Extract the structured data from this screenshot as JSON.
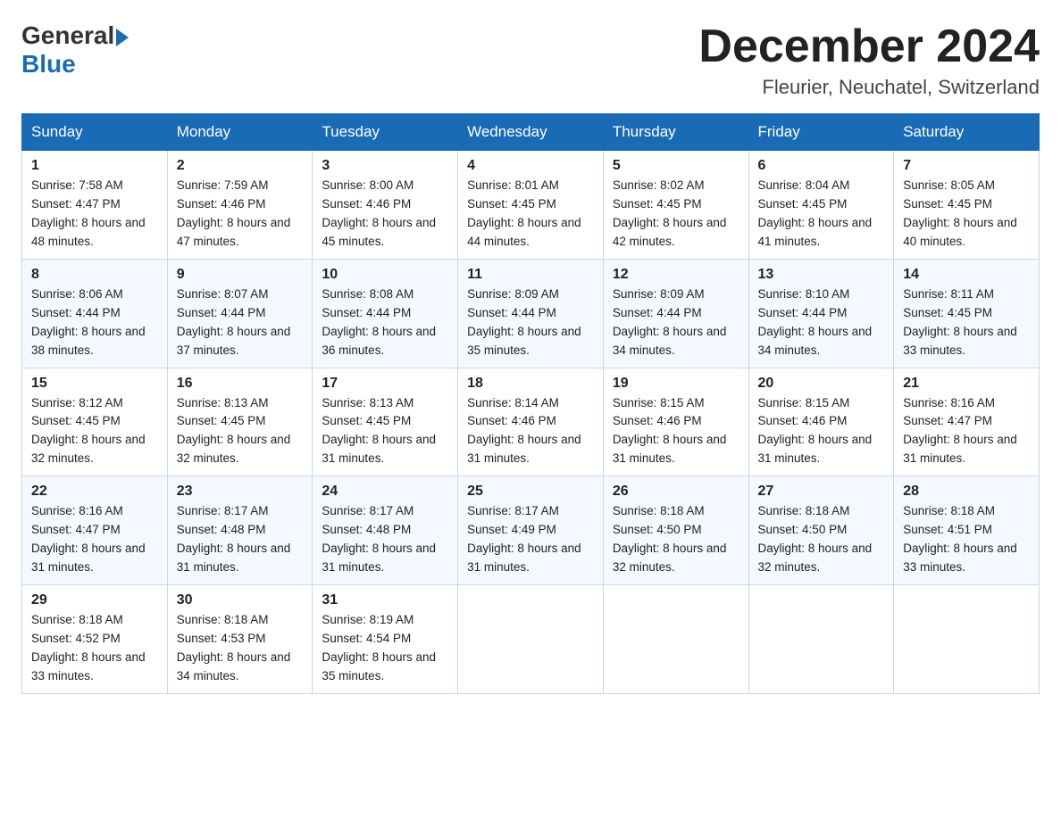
{
  "header": {
    "month_title": "December 2024",
    "location": "Fleurier, Neuchatel, Switzerland"
  },
  "columns": [
    "Sunday",
    "Monday",
    "Tuesday",
    "Wednesday",
    "Thursday",
    "Friday",
    "Saturday"
  ],
  "weeks": [
    [
      {
        "day": "1",
        "sunrise": "7:58 AM",
        "sunset": "4:47 PM",
        "daylight": "8 hours and 48 minutes."
      },
      {
        "day": "2",
        "sunrise": "7:59 AM",
        "sunset": "4:46 PM",
        "daylight": "8 hours and 47 minutes."
      },
      {
        "day": "3",
        "sunrise": "8:00 AM",
        "sunset": "4:46 PM",
        "daylight": "8 hours and 45 minutes."
      },
      {
        "day": "4",
        "sunrise": "8:01 AM",
        "sunset": "4:45 PM",
        "daylight": "8 hours and 44 minutes."
      },
      {
        "day": "5",
        "sunrise": "8:02 AM",
        "sunset": "4:45 PM",
        "daylight": "8 hours and 42 minutes."
      },
      {
        "day": "6",
        "sunrise": "8:04 AM",
        "sunset": "4:45 PM",
        "daylight": "8 hours and 41 minutes."
      },
      {
        "day": "7",
        "sunrise": "8:05 AM",
        "sunset": "4:45 PM",
        "daylight": "8 hours and 40 minutes."
      }
    ],
    [
      {
        "day": "8",
        "sunrise": "8:06 AM",
        "sunset": "4:44 PM",
        "daylight": "8 hours and 38 minutes."
      },
      {
        "day": "9",
        "sunrise": "8:07 AM",
        "sunset": "4:44 PM",
        "daylight": "8 hours and 37 minutes."
      },
      {
        "day": "10",
        "sunrise": "8:08 AM",
        "sunset": "4:44 PM",
        "daylight": "8 hours and 36 minutes."
      },
      {
        "day": "11",
        "sunrise": "8:09 AM",
        "sunset": "4:44 PM",
        "daylight": "8 hours and 35 minutes."
      },
      {
        "day": "12",
        "sunrise": "8:09 AM",
        "sunset": "4:44 PM",
        "daylight": "8 hours and 34 minutes."
      },
      {
        "day": "13",
        "sunrise": "8:10 AM",
        "sunset": "4:44 PM",
        "daylight": "8 hours and 34 minutes."
      },
      {
        "day": "14",
        "sunrise": "8:11 AM",
        "sunset": "4:45 PM",
        "daylight": "8 hours and 33 minutes."
      }
    ],
    [
      {
        "day": "15",
        "sunrise": "8:12 AM",
        "sunset": "4:45 PM",
        "daylight": "8 hours and 32 minutes."
      },
      {
        "day": "16",
        "sunrise": "8:13 AM",
        "sunset": "4:45 PM",
        "daylight": "8 hours and 32 minutes."
      },
      {
        "day": "17",
        "sunrise": "8:13 AM",
        "sunset": "4:45 PM",
        "daylight": "8 hours and 31 minutes."
      },
      {
        "day": "18",
        "sunrise": "8:14 AM",
        "sunset": "4:46 PM",
        "daylight": "8 hours and 31 minutes."
      },
      {
        "day": "19",
        "sunrise": "8:15 AM",
        "sunset": "4:46 PM",
        "daylight": "8 hours and 31 minutes."
      },
      {
        "day": "20",
        "sunrise": "8:15 AM",
        "sunset": "4:46 PM",
        "daylight": "8 hours and 31 minutes."
      },
      {
        "day": "21",
        "sunrise": "8:16 AM",
        "sunset": "4:47 PM",
        "daylight": "8 hours and 31 minutes."
      }
    ],
    [
      {
        "day": "22",
        "sunrise": "8:16 AM",
        "sunset": "4:47 PM",
        "daylight": "8 hours and 31 minutes."
      },
      {
        "day": "23",
        "sunrise": "8:17 AM",
        "sunset": "4:48 PM",
        "daylight": "8 hours and 31 minutes."
      },
      {
        "day": "24",
        "sunrise": "8:17 AM",
        "sunset": "4:48 PM",
        "daylight": "8 hours and 31 minutes."
      },
      {
        "day": "25",
        "sunrise": "8:17 AM",
        "sunset": "4:49 PM",
        "daylight": "8 hours and 31 minutes."
      },
      {
        "day": "26",
        "sunrise": "8:18 AM",
        "sunset": "4:50 PM",
        "daylight": "8 hours and 32 minutes."
      },
      {
        "day": "27",
        "sunrise": "8:18 AM",
        "sunset": "4:50 PM",
        "daylight": "8 hours and 32 minutes."
      },
      {
        "day": "28",
        "sunrise": "8:18 AM",
        "sunset": "4:51 PM",
        "daylight": "8 hours and 33 minutes."
      }
    ],
    [
      {
        "day": "29",
        "sunrise": "8:18 AM",
        "sunset": "4:52 PM",
        "daylight": "8 hours and 33 minutes."
      },
      {
        "day": "30",
        "sunrise": "8:18 AM",
        "sunset": "4:53 PM",
        "daylight": "8 hours and 34 minutes."
      },
      {
        "day": "31",
        "sunrise": "8:19 AM",
        "sunset": "4:54 PM",
        "daylight": "8 hours and 35 minutes."
      },
      null,
      null,
      null,
      null
    ]
  ]
}
